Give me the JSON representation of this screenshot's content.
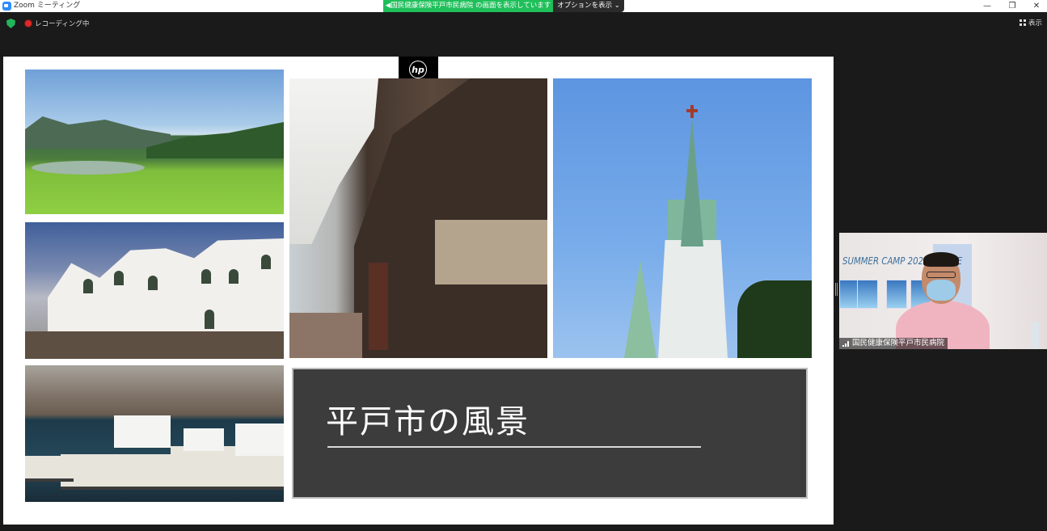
{
  "window": {
    "title": "Zoom ミーティング",
    "controls": {
      "minimize": "—",
      "restore": "❐",
      "close": "✕"
    }
  },
  "share_banner": {
    "text": "◀国民健康保険平戸市民病院 の画面を表示しています",
    "options_label": "オプションを表示 ⌄",
    "color": "#1fbf5a"
  },
  "meeting_bar": {
    "security_icon": "shield-icon",
    "recording_label": "レコーディング中",
    "view_label": "表示"
  },
  "shared_slide": {
    "logo_text": "hp",
    "title": "平戸市の風景",
    "photos": [
      "rice-terraces-photo",
      "white-building-photo",
      "fishing-harbor-photo",
      "old-street-photo",
      "cathedral-photo"
    ]
  },
  "participant": {
    "name": "国民健康保険平戸市民病院",
    "background_text": "SUMMER CAMP 2021 ONLINE"
  }
}
